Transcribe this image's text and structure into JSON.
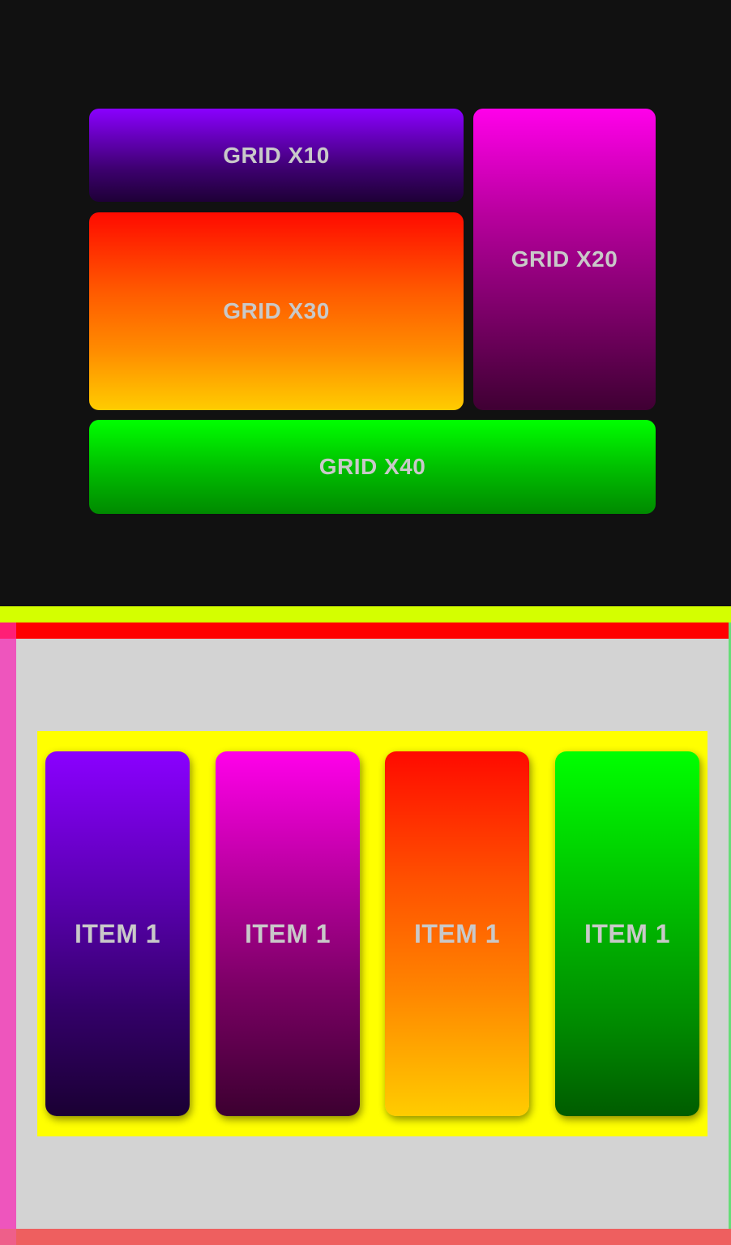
{
  "grid": {
    "tiles": [
      {
        "label": "GRID X10"
      },
      {
        "label": "GRID X20"
      },
      {
        "label": "GRID X30"
      },
      {
        "label": "GRID X40"
      }
    ]
  },
  "flex": {
    "items": [
      {
        "label": "ITEM 1"
      },
      {
        "label": "ITEM 1"
      },
      {
        "label": "ITEM 1"
      },
      {
        "label": "ITEM 1"
      }
    ]
  },
  "colors": {
    "page_background": "#111111",
    "content_background": "#d3d3d3",
    "container_background": "#ffff00",
    "band_lime": "#d4ff00",
    "band_red": "#ff0000",
    "border_left": "#ee55bd",
    "border_bottom": "#ee5f5f",
    "border_right": "#66dd77",
    "label_text": "#c9c9c9",
    "purple": "#8a00ff",
    "magenta": "#ff00ea",
    "orange_red": "#ff0a00",
    "yellow": "#ffcc00",
    "green": "#00ff00"
  }
}
